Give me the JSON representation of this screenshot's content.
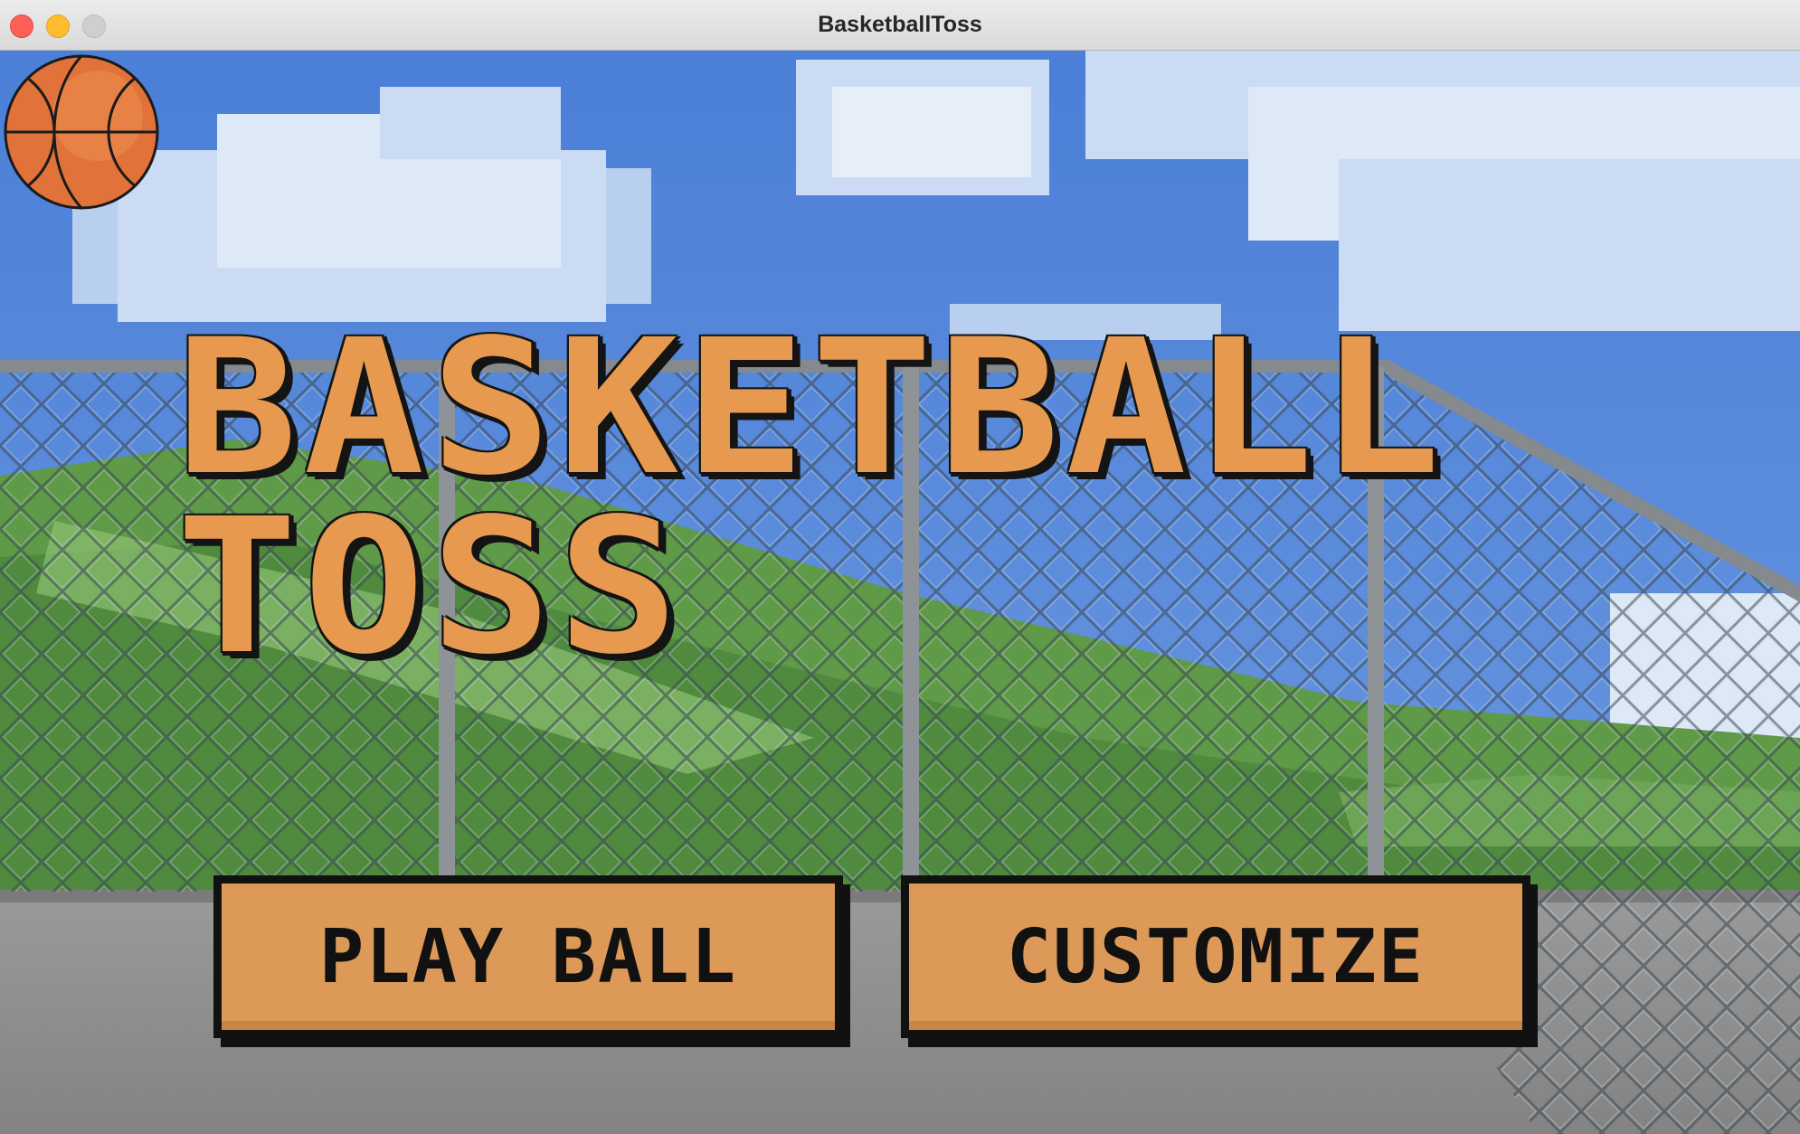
{
  "window": {
    "title": "BasketballToss",
    "controls": [
      "close",
      "minimize",
      "maximize"
    ]
  },
  "game": {
    "title_line1": "BASKETBALL",
    "title_line2": "TOSS",
    "title_color": "#e79a4f",
    "ball_icon": "basketball-icon"
  },
  "menu": {
    "play_label": "PLAY BALL",
    "customize_label": "CUSTOMIZE",
    "button_color": "#dc9958"
  },
  "scene": {
    "background": "court-behind-chain-link-fence",
    "sky_color": "#4c7fd6",
    "court_color": "#8e8e8e",
    "grass_color": "#5f9a48"
  }
}
